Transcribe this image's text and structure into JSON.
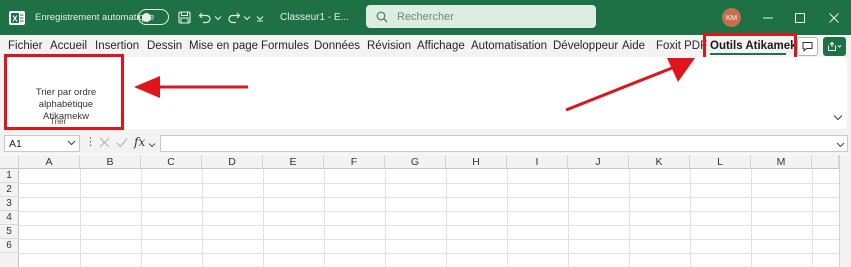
{
  "title_bar": {
    "autosave_label": "Enregistrement automatique",
    "file_name": "Classeur1 - E...",
    "search_placeholder": "Rechercher",
    "user_initials": "KM",
    "colors": {
      "background": "#1e7145",
      "search_bg": "#dceee2",
      "avatar": "#c4704e"
    }
  },
  "menu": {
    "tabs": [
      {
        "label": "Fichier"
      },
      {
        "label": "Accueil"
      },
      {
        "label": "Insertion"
      },
      {
        "label": "Dessin"
      },
      {
        "label": "Mise en page"
      },
      {
        "label": "Formules"
      },
      {
        "label": "Données"
      },
      {
        "label": "Révision"
      },
      {
        "label": "Affichage"
      },
      {
        "label": "Automatisation"
      },
      {
        "label": "Développeur"
      },
      {
        "label": "Aide"
      },
      {
        "label": "Foxit PDF"
      },
      {
        "label": "Outils Atikamekw"
      }
    ],
    "active_tab": "Outils Atikamekw"
  },
  "ribbon": {
    "sort_button_label": "Trier par ordre alphabétique Atikamekw",
    "group_label": "Trier"
  },
  "formula_bar": {
    "name_box_value": "A1",
    "fx_label": "fx"
  },
  "sheet": {
    "columns": [
      "A",
      "B",
      "C",
      "D",
      "E",
      "F",
      "G",
      "H",
      "I",
      "J",
      "K",
      "L",
      "M"
    ],
    "rows": [
      "1",
      "2",
      "3",
      "4",
      "5",
      "6"
    ]
  },
  "annotations": {
    "highlight_color": "#e0141b"
  }
}
